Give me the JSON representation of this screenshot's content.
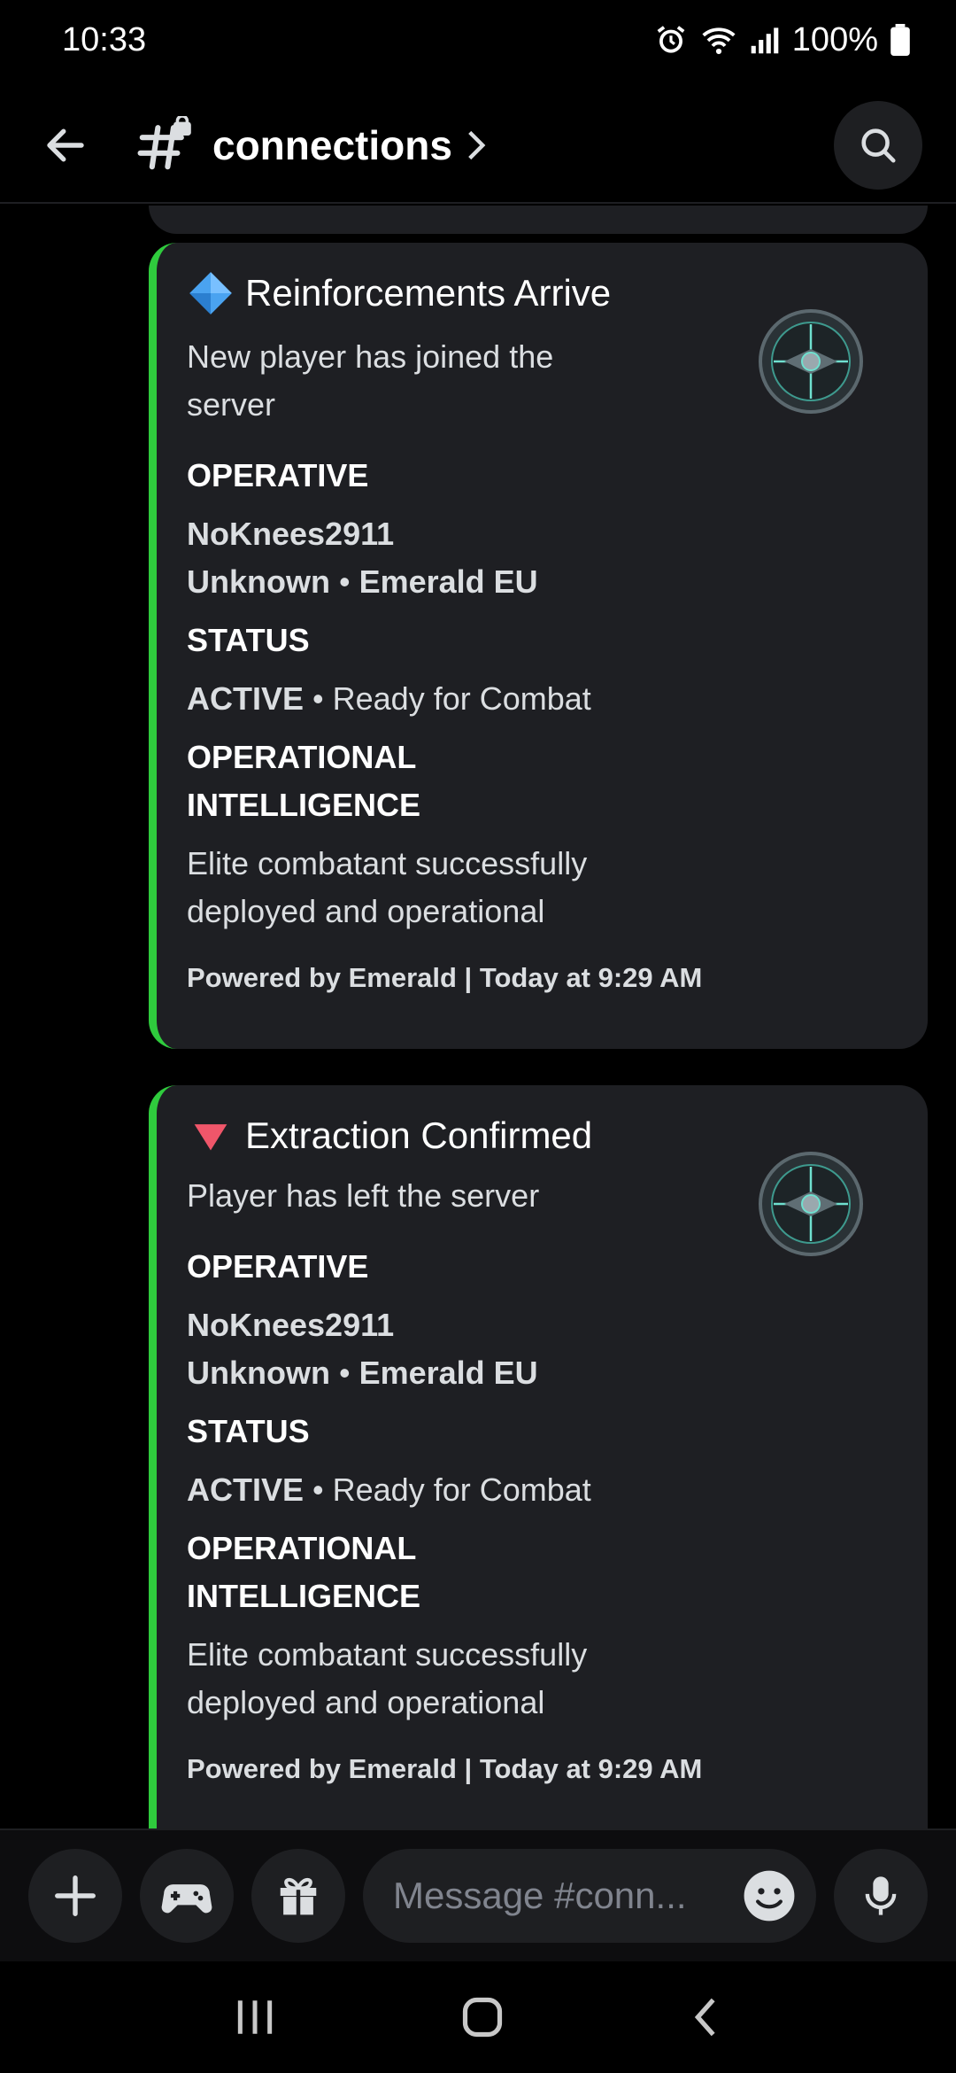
{
  "status_bar": {
    "time": "10:33",
    "battery": "100%"
  },
  "header": {
    "channel_name": "connections"
  },
  "embeds": [
    {
      "title": "Reinforcements Arrive",
      "title_icon": "blue-diamond-icon",
      "description": "New player has joined the server",
      "operative_label": "OPERATIVE",
      "operative_name": "NoKnees2911",
      "operative_rank": "Unknown",
      "operative_server": "Emerald EU",
      "status_label": "STATUS",
      "status_value": "ACTIVE",
      "status_detail": "Ready for Combat",
      "intel_label": "OPERATIONAL INTELLIGENCE",
      "intel_value": "Elite combatant successfully deployed and operational",
      "footer": "Powered by Emerald | Today at 9:29 AM",
      "accent": "#2fcb3d"
    },
    {
      "title": "Extraction Confirmed",
      "title_icon": "red-triangle-down-icon",
      "description": "Player has left the server",
      "operative_label": "OPERATIVE",
      "operative_name": "NoKnees2911",
      "operative_rank": "Unknown",
      "operative_server": "Emerald EU",
      "status_label": "STATUS",
      "status_value": "ACTIVE",
      "status_detail": "Ready for Combat",
      "intel_label": "OPERATIONAL INTELLIGENCE",
      "intel_value": "Elite combatant successfully deployed and operational",
      "footer": "Powered by Emerald | Today at 9:29 AM",
      "accent": "#2fcb3d"
    }
  ],
  "composer": {
    "placeholder": "Message #conn..."
  },
  "colors": {
    "background": "#000000",
    "card": "#1e1f23",
    "accent_green": "#2fcb3d"
  }
}
